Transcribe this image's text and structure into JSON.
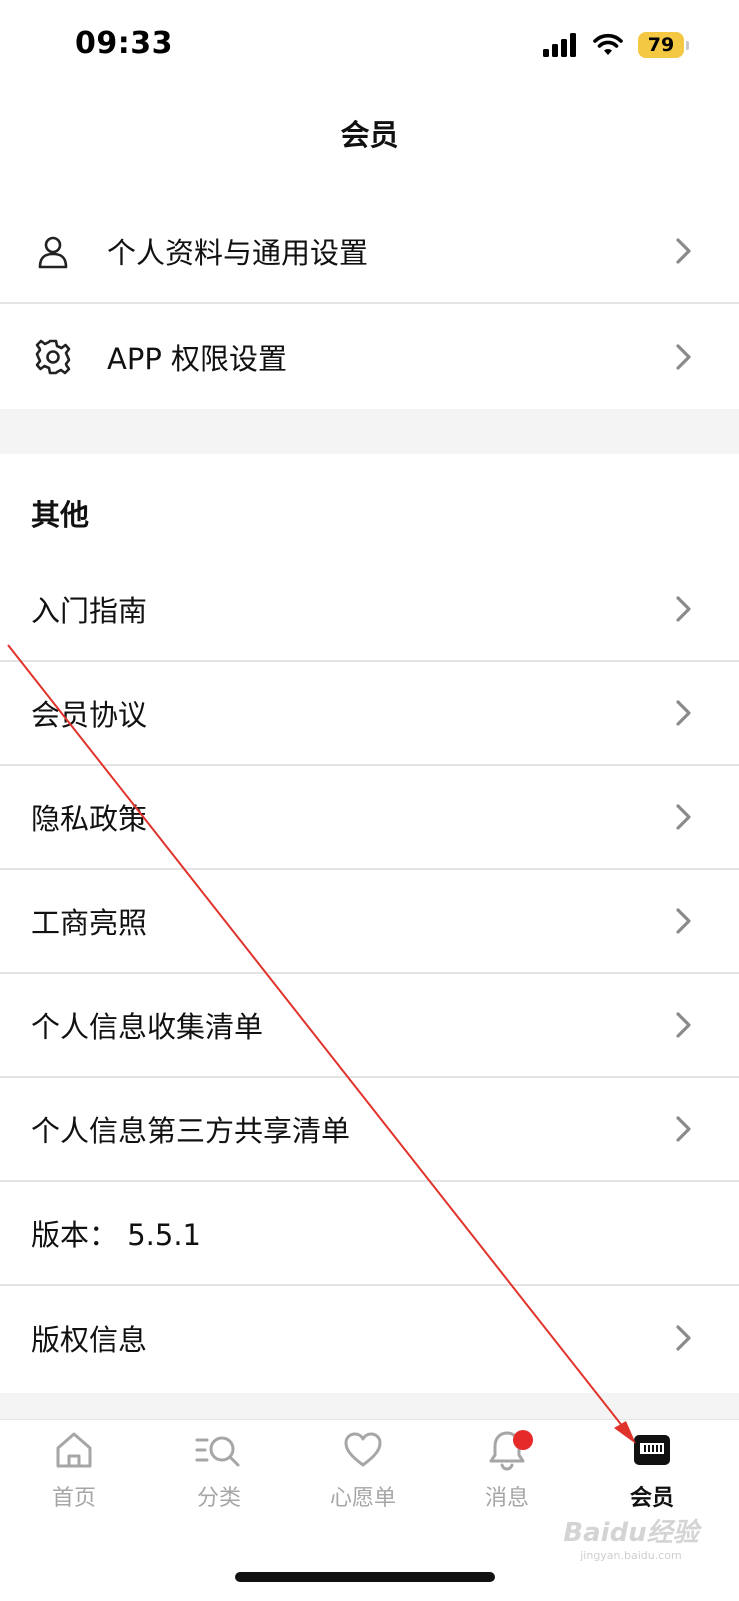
{
  "status_bar": {
    "time": "09:33",
    "battery": "79",
    "icons": [
      "signal-icon",
      "wifi-icon",
      "battery-icon"
    ]
  },
  "header": {
    "title": "会员"
  },
  "settings": [
    {
      "label": "个人资料与通用设置",
      "icon": "user-icon"
    },
    {
      "label": "APP 权限设置",
      "icon": "gear-icon"
    }
  ],
  "other": {
    "title": "其他",
    "items": [
      {
        "label": "入门指南",
        "has_chevron": true
      },
      {
        "label": "会员协议",
        "has_chevron": true
      },
      {
        "label": "隐私政策",
        "has_chevron": true
      },
      {
        "label": "工商亮照",
        "has_chevron": true
      },
      {
        "label": "个人信息收集清单",
        "has_chevron": true
      },
      {
        "label": "个人信息第三方共享清单",
        "has_chevron": true
      },
      {
        "label": "版本：  5.5.1",
        "has_chevron": false
      },
      {
        "label": "版权信息",
        "has_chevron": true
      }
    ]
  },
  "tab_bar": {
    "tabs": [
      {
        "label": "首页",
        "icon": "home-icon",
        "active": false
      },
      {
        "label": "分类",
        "icon": "category-search-icon",
        "active": false
      },
      {
        "label": "心愿单",
        "icon": "heart-icon",
        "active": false
      },
      {
        "label": "消息",
        "icon": "bell-icon",
        "active": false,
        "badge": true
      },
      {
        "label": "会员",
        "icon": "member-card-icon",
        "active": true
      }
    ]
  },
  "colors": {
    "accent_text": "#111111",
    "inactive_tab": "#a6a6a6",
    "badge": "#e62a2a",
    "battery": "#f4c842",
    "annotation_arrow": "#e0332b"
  },
  "watermark": {
    "logo": "Baidu经验",
    "sub": "jingyan.baidu.com"
  }
}
